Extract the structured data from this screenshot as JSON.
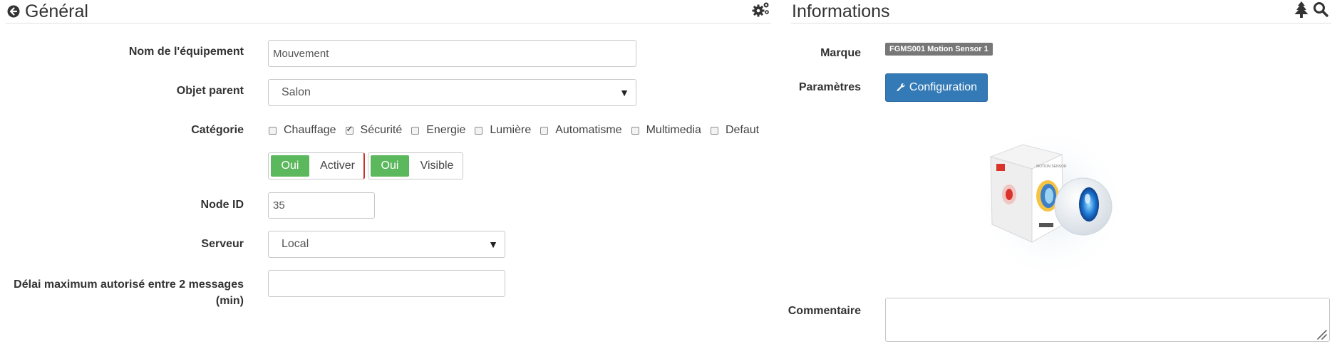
{
  "general": {
    "title": "Général",
    "fields": {
      "name": {
        "label": "Nom de l'équipement",
        "value": "Mouvement"
      },
      "parent": {
        "label": "Objet parent",
        "value": "Salon"
      },
      "category": {
        "label": "Catégorie",
        "options": [
          {
            "label": "Chauffage",
            "checked": false
          },
          {
            "label": "Sécurité",
            "checked": true
          },
          {
            "label": "Energie",
            "checked": false
          },
          {
            "label": "Lumière",
            "checked": false
          },
          {
            "label": "Automatisme",
            "checked": false
          },
          {
            "label": "Multimedia",
            "checked": false
          },
          {
            "label": "Defaut",
            "checked": false
          }
        ]
      },
      "enable_toggle": {
        "on_label": "Oui",
        "text": "Activer"
      },
      "visible_toggle": {
        "on_label": "Oui",
        "text": "Visible"
      },
      "node_id": {
        "label": "Node ID",
        "value": "35"
      },
      "server": {
        "label": "Serveur",
        "value": "Local"
      },
      "max_delay": {
        "label_line1": "Délai maximum autorisé entre 2 messages",
        "label_line2": "(min)",
        "value": ""
      }
    }
  },
  "informations": {
    "title": "Informations",
    "brand": {
      "label": "Marque",
      "value": "FGMS001 Motion Sensor 1"
    },
    "params": {
      "label": "Paramètres",
      "button_label": "Configuration"
    },
    "product_image": {
      "box_text": "MOTION SENSOR"
    },
    "comment": {
      "label": "Commentaire",
      "value": ""
    }
  },
  "colors": {
    "toggle_on": "#5cb85c",
    "primary_button": "#337ab7",
    "badge": "#777777",
    "divider": "#e2e2e2"
  },
  "icons": [
    "circle-arrow-left-icon",
    "gears-icon",
    "tree-icon",
    "search-icon",
    "wrench-icon",
    "caret-down-icon",
    "checkbox-icon",
    "resize-handle-icon"
  ]
}
